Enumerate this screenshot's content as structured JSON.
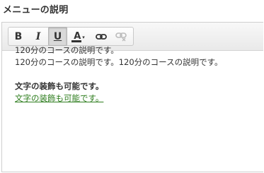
{
  "title": "メニューの説明",
  "toolbar": {
    "bold_label": "B",
    "italic_label": "I",
    "underline_label": "U",
    "color_label": "A",
    "color_caret": "▾",
    "buttons": [
      {
        "name": "bold",
        "icon": "bold-icon"
      },
      {
        "name": "italic",
        "icon": "italic-icon"
      },
      {
        "name": "underline",
        "icon": "underline-icon",
        "active": true
      },
      {
        "name": "text-color",
        "icon": "text-color-icon",
        "color": "#333333"
      },
      {
        "name": "link",
        "icon": "link-icon"
      },
      {
        "name": "unlink",
        "icon": "unlink-icon",
        "disabled": true
      }
    ]
  },
  "content": {
    "line1": "120分のコースの説明です。",
    "line2": "120分のコースの説明です。120分のコースの説明です。",
    "line3": "文字の装飾も可能です。",
    "line4": "文字の装飾も可能です。"
  },
  "colors": {
    "link_text": "#2e7d1e",
    "text": "#333333",
    "toolbar_bg": "#f0f0f0"
  }
}
